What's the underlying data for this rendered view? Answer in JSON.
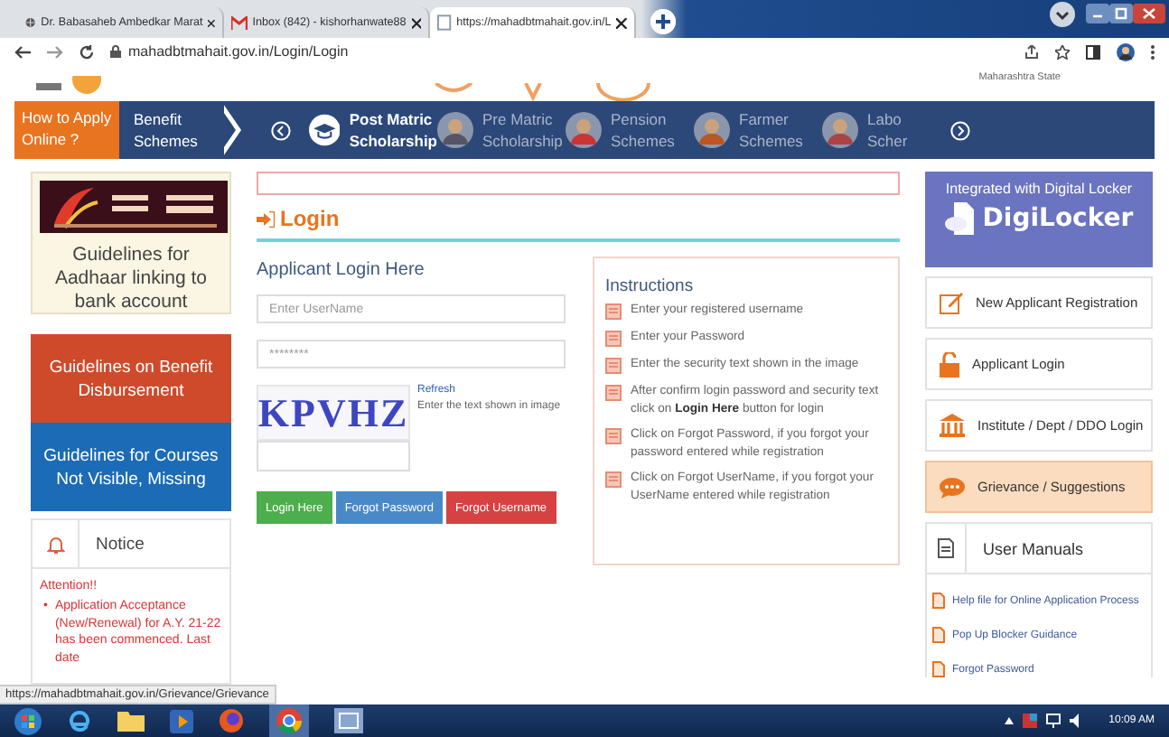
{
  "browser": {
    "tabs": [
      {
        "title": "Dr. Babasaheb Ambedkar Marat",
        "kind": "site",
        "selected": false
      },
      {
        "title": "Inbox (842) - kishorhanwate88",
        "kind": "mail",
        "selected": false
      },
      {
        "title": "https://mahadbtmahait.gov.in/L",
        "kind": "page",
        "selected": true
      }
    ],
    "address": "mahadbtmahait.gov.in/Login/Login"
  },
  "banner": {
    "caption": "Maharashtra State"
  },
  "nav": {
    "how_to": "How to Apply Online ?",
    "benefit": "Benefit Schemes",
    "items": [
      {
        "lines": [
          "Post Matric",
          "Scholarship"
        ],
        "selected": true
      },
      {
        "lines": [
          "Pre Matric",
          "Scholarship"
        ],
        "selected": false
      },
      {
        "lines": [
          "Pension",
          "Schemes"
        ],
        "selected": false
      },
      {
        "lines": [
          "Farmer",
          "Schemes"
        ],
        "selected": false
      },
      {
        "lines": [
          "Labo",
          "Scher"
        ],
        "selected": false
      }
    ]
  },
  "left": {
    "aadhaar": "Guidelines for Aadhaar linking to bank account",
    "disbursement": "Guidelines on Benefit Disbursement",
    "courses": "Guidelines for Courses Not Visible, Missing",
    "notice": {
      "title": "Notice",
      "attention": "Attention!!",
      "items": [
        {
          "marker": "•",
          "text": "Application Acceptance (New/Renewal) for A.Y. 21-22 has been commenced. Last date"
        }
      ]
    }
  },
  "login": {
    "title": "Login",
    "subtitle": "Applicant Login Here",
    "username": {
      "placeholder": "Enter UserName"
    },
    "password": {
      "placeholder": "********"
    },
    "captcha": "KPVHZ",
    "refresh": "Refresh",
    "captcha_hint": "Enter the text shown in image",
    "buttons": [
      {
        "label": "Login Here",
        "kind": "success"
      },
      {
        "label": "Forgot Password",
        "kind": "info"
      },
      {
        "label": "Forgot Username",
        "kind": "danger"
      }
    ]
  },
  "instructions": {
    "title": "Instructions",
    "items": [
      "Enter your registered username",
      "Enter your Password",
      "Enter the security text shown in the image",
      "After confirm login password and security text click on **Login Here** button for login",
      "Click on Forgot Password, if you forgot your password entered while registration",
      "Click on Forgot UserName, if you forgot your UserName entered while registration"
    ]
  },
  "digilocker": {
    "heading": "Integrated with Digital Locker",
    "brand": "DigiLocker"
  },
  "right_links": [
    {
      "label": "New Applicant Registration",
      "kind": "pencil",
      "highlighted": false
    },
    {
      "label": "Applicant Login",
      "kind": "lock",
      "highlighted": false
    },
    {
      "label": "Institute / Dept / DDO Login",
      "kind": "bank",
      "highlighted": false
    },
    {
      "label": "Grievance / Suggestions",
      "kind": "chat",
      "highlighted": true
    }
  ],
  "manuals": {
    "title": "User Manuals",
    "items": [
      "Help file for Online Application Process",
      "Pop Up Blocker Guidance",
      "Forgot Password"
    ]
  },
  "status_url": "https://mahadbtmahait.gov.in/Grievance/Grievance",
  "taskbar": {
    "time": "10:09 AM"
  }
}
